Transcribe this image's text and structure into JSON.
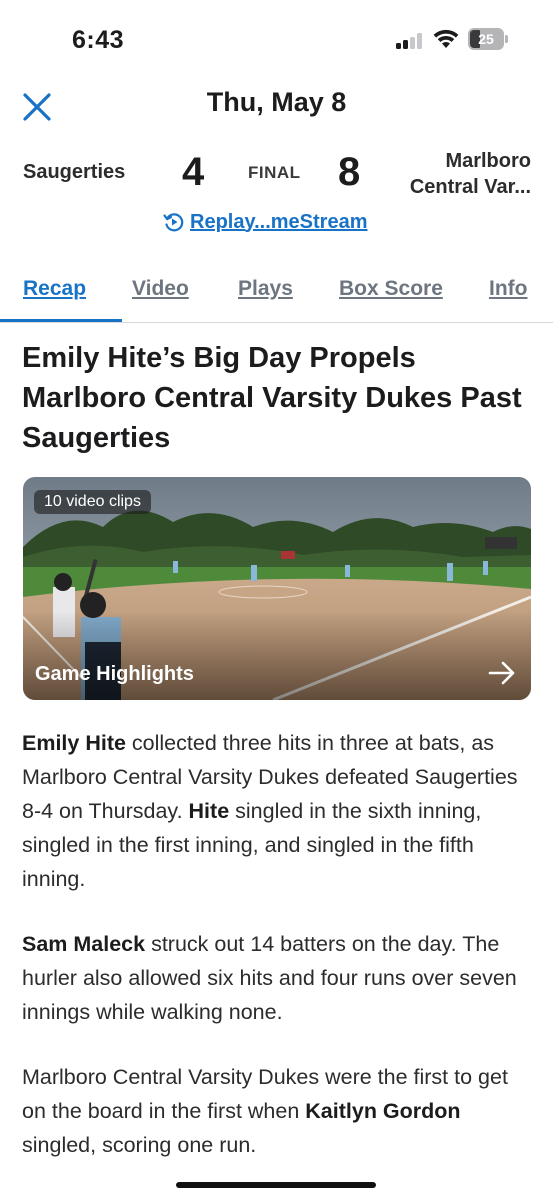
{
  "status_bar": {
    "time": "6:43",
    "battery_level": "25"
  },
  "header": {
    "date": "Thu, May 8"
  },
  "scoreboard": {
    "home_team": "Saugerties",
    "home_score": "4",
    "status": "FINAL",
    "away_score": "8",
    "away_team_line1": "Marlboro",
    "away_team_line2": "Central Var...",
    "replay_link": "Replay...meStream"
  },
  "tabs": [
    {
      "label": "Recap",
      "active": true
    },
    {
      "label": "Video",
      "active": false
    },
    {
      "label": "Plays",
      "active": false
    },
    {
      "label": "Box Score",
      "active": false
    },
    {
      "label": "Info",
      "active": false
    }
  ],
  "article": {
    "headline": "Emily Hite’s Big Day Propels Marlboro Central Varsity Dukes Past Saugerties",
    "video": {
      "clip_count_label": "10 video clips",
      "title": "Game Highlights"
    },
    "paragraphs": [
      [
        {
          "text": "Emily Hite",
          "bold": true
        },
        {
          "text": " collected three hits in three at bats, as Marlboro Central Varsity Dukes defeated Saugerties 8-4 on Thursday. ",
          "bold": false
        },
        {
          "text": "Hite",
          "bold": true
        },
        {
          "text": " singled in the sixth inning, singled in the first inning, and singled in the fifth inning.",
          "bold": false
        }
      ],
      [
        {
          "text": "Sam Maleck",
          "bold": true
        },
        {
          "text": " struck out 14 batters on the day. The hurler also allowed six hits and four runs over seven innings while walking none.",
          "bold": false
        }
      ],
      [
        {
          "text": "Marlboro Central Varsity Dukes were the first to get on the board in the first when ",
          "bold": false
        },
        {
          "text": "Kaitlyn Gordon",
          "bold": true
        },
        {
          "text": " singled, scoring one run.",
          "bold": false
        }
      ]
    ]
  },
  "colors": {
    "accent": "#1873c7",
    "tab_inactive": "#6d7680",
    "text": "#1c1c1e"
  },
  "icons": [
    "signal-icon",
    "wifi-icon",
    "battery-icon",
    "close-icon",
    "replay-icon",
    "arrow-right-icon"
  ]
}
